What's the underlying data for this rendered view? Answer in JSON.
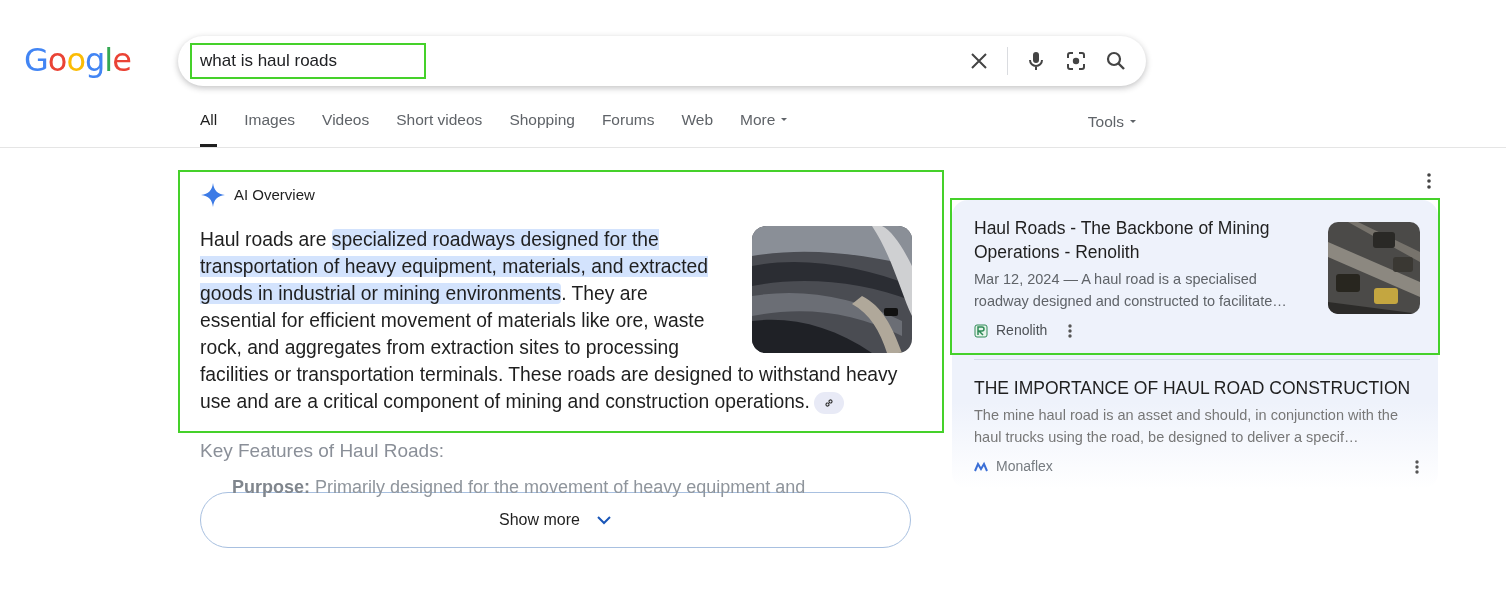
{
  "logo": "Google",
  "search": {
    "value": "what is haul roads",
    "highlighted": true
  },
  "tabs": [
    {
      "label": "All",
      "selected": true,
      "kind": "tab"
    },
    {
      "label": "Images",
      "selected": false,
      "kind": "tab"
    },
    {
      "label": "Videos",
      "selected": false,
      "kind": "tab"
    },
    {
      "label": "Short videos",
      "selected": false,
      "kind": "tab"
    },
    {
      "label": "Shopping",
      "selected": false,
      "kind": "tab"
    },
    {
      "label": "Forums",
      "selected": false,
      "kind": "tab"
    },
    {
      "label": "Web",
      "selected": false,
      "kind": "tab"
    },
    {
      "label": "More",
      "selected": false,
      "kind": "dropdown"
    }
  ],
  "tools": {
    "label": "Tools"
  },
  "ai_overview": {
    "title": "AI Overview",
    "highlighted": true,
    "segments": [
      {
        "text": "Haul roads are ",
        "highlighted": false
      },
      {
        "text": "specialized roadways designed for the transportation of heavy equipment, materials, and extracted goods in industrial or mining environments",
        "highlighted": true
      },
      {
        "text": ". They are essential for efficient movement of materials like ore, waste rock, and aggregates from extraction sites to processing facilities or transportation terminals. These roads are designed to withstand heavy use and are a critical component of mining and construction operations.",
        "highlighted": false
      }
    ],
    "key_features_heading": "Key Features of Haul Roads:",
    "list_items": [
      "**Purpose:** Primarily designed for the movement of heavy equipment and"
    ],
    "show_more": "Show more"
  },
  "results": [
    {
      "title": "Haul Roads - The Backbone of Mining Operations - Renolith",
      "snippet": "Mar 12, 2024 — A haul road is a specialised roadway designed and constructed to facilitate…",
      "source": "Renolith",
      "highlighted": true,
      "faded": false,
      "has_image": true
    },
    {
      "title": "THE IMPORTANCE OF HAUL ROAD CONSTRUCTION",
      "snippet": "The mine haul road is an asset and should, in conjunction with the haul trucks using the road, be designed to deliver a specif…",
      "source": "Monaflex",
      "highlighted": false,
      "faded": true,
      "has_image": false
    }
  ]
}
